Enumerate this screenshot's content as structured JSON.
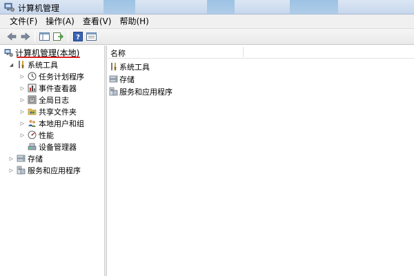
{
  "window": {
    "title": "计算机管理",
    "icon": "computer-management-icon"
  },
  "menu": {
    "items": [
      {
        "label": "文件(F)"
      },
      {
        "label": "操作(A)"
      },
      {
        "label": "查看(V)"
      },
      {
        "label": "帮助(H)"
      }
    ]
  },
  "toolbar": {
    "buttons": [
      {
        "icon": "back-arrow-icon"
      },
      {
        "icon": "forward-arrow-icon"
      },
      {
        "icon": "show-hide-tree-icon"
      },
      {
        "icon": "export-list-icon"
      },
      {
        "icon": "help-icon"
      },
      {
        "icon": "properties-icon"
      }
    ]
  },
  "tree": {
    "root": {
      "label": "计算机管理(本地)",
      "icon": "computer-management-icon"
    },
    "system_tools": {
      "label": "系统工具",
      "icon": "tools-icon",
      "children": [
        {
          "label": "任务计划程序",
          "icon": "clock-icon"
        },
        {
          "label": "事件查看器",
          "icon": "event-viewer-icon"
        },
        {
          "label": "全局日志",
          "icon": "log-icon"
        },
        {
          "label": "共享文件夹",
          "icon": "shared-folder-icon"
        },
        {
          "label": "本地用户和组",
          "icon": "users-icon"
        },
        {
          "label": "性能",
          "icon": "performance-icon"
        },
        {
          "label": "设备管理器",
          "icon": "device-manager-icon"
        }
      ]
    },
    "storage": {
      "label": "存储",
      "icon": "storage-icon"
    },
    "services": {
      "label": "服务和应用程序",
      "icon": "services-icon"
    }
  },
  "list": {
    "column_name": "名称",
    "rows": [
      {
        "label": "系统工具",
        "icon": "tools-icon"
      },
      {
        "label": "存储",
        "icon": "storage-icon"
      },
      {
        "label": "服务和应用程序",
        "icon": "services-icon"
      }
    ]
  },
  "colors": {
    "highlight_underline": "#d62020",
    "titlebar": "#c7d7ec"
  }
}
